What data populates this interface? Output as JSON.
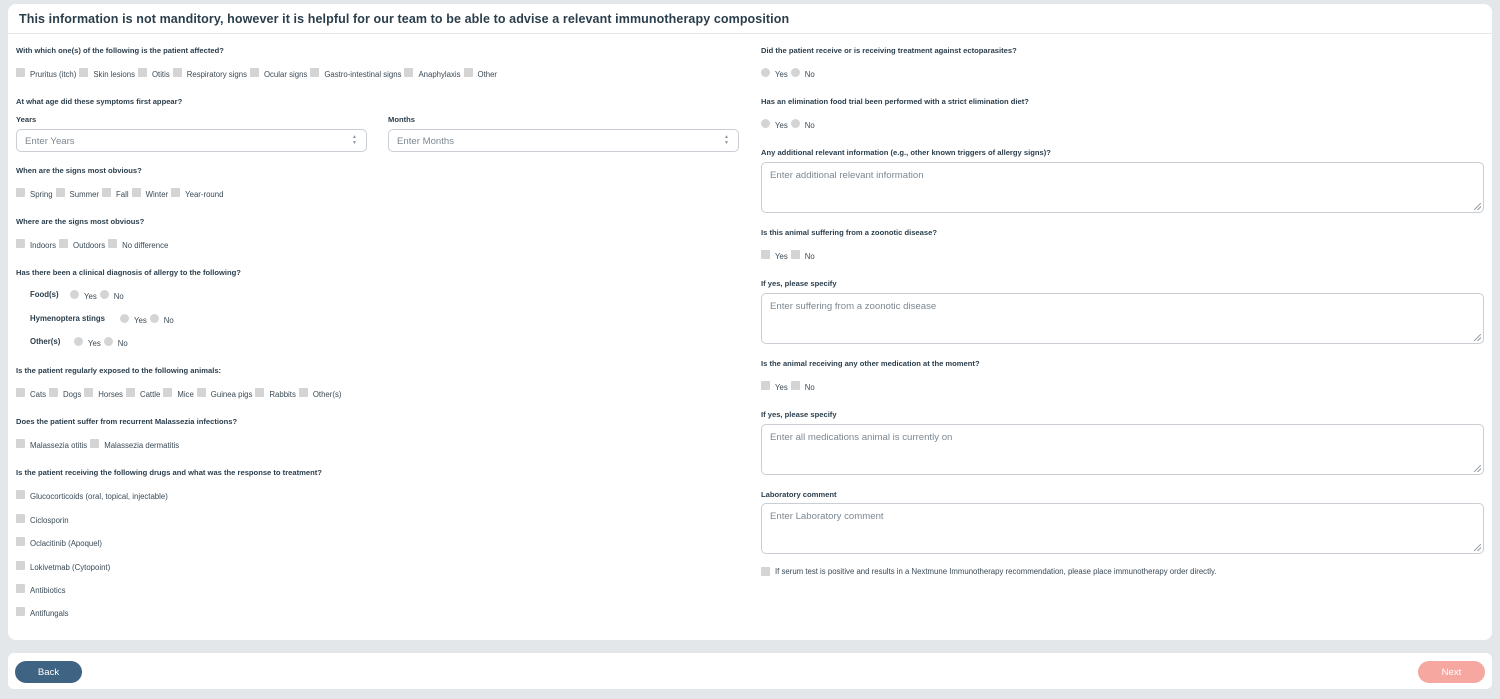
{
  "header": {
    "title": "This information is not manditory, however it is helpful for our team to be able to advise a relevant immunotherapy composition"
  },
  "left": {
    "affected": {
      "question": "With which one(s) of the following is the patient affected?",
      "options": [
        "Pruritus (itch)",
        "Skin lesions",
        "Otitis",
        "Respiratory signs",
        "Ocular signs",
        "Gastro-intestinal signs",
        "Anaphylaxis",
        "Other"
      ]
    },
    "age": {
      "question": "At what age did these symptoms first appear?",
      "years_label": "Years",
      "years_placeholder": "Enter Years",
      "months_label": "Months",
      "months_placeholder": "Enter Months"
    },
    "seasons": {
      "question": "When are the signs most obvious?",
      "options": [
        "Spring",
        "Summer",
        "Fall",
        "Winter",
        "Year-round"
      ]
    },
    "location": {
      "question": "Where are the signs most obvious?",
      "options": [
        "Indoors",
        "Outdoors",
        "No difference"
      ]
    },
    "diagnosis": {
      "question": "Has there been a clinical diagnosis of allergy to the following?",
      "rows": [
        {
          "label": "Food(s)",
          "yes": "Yes",
          "no": "No"
        },
        {
          "label": "Hymenoptera stings",
          "yes": "Yes",
          "no": "No"
        },
        {
          "label": "Other(s)",
          "yes": "Yes",
          "no": "No"
        }
      ]
    },
    "animals": {
      "question": "Is the patient regularly exposed to the following animals:",
      "options": [
        "Cats",
        "Dogs",
        "Horses",
        "Cattle",
        "Mice",
        "Guinea pigs",
        "Rabbits",
        "Other(s)"
      ]
    },
    "malassezia": {
      "question": "Does the patient suffer from recurrent Malassezia infections?",
      "options": [
        "Malassezia otitis",
        "Malassezia dermatitis"
      ]
    },
    "drugs": {
      "question": "Is the patient receiving the following drugs and what was the response to treatment?",
      "options": [
        "Glucocorticoids (oral, topical, injectable)",
        "Ciclosporin",
        "Oclacitinib (Apoquel)",
        "Lokivetmab (Cytopoint)",
        "Antibiotics",
        "Antifungals"
      ]
    }
  },
  "right": {
    "ectoparasites": {
      "question": "Did the patient receive or is receiving treatment against ectoparasites?",
      "yes": "Yes",
      "no": "No"
    },
    "elimination": {
      "question": "Has an elimination food trial been performed with a strict elimination diet?",
      "yes": "Yes",
      "no": "No"
    },
    "additional": {
      "question": "Any additional relevant information (e.g., other known triggers of allergy signs)?",
      "placeholder": "Enter additional relevant information"
    },
    "zoonotic": {
      "question": "Is this animal suffering from a zoonotic disease?",
      "yes": "Yes",
      "no": "No"
    },
    "zoonotic_specify": {
      "question": "If yes, please specify",
      "placeholder": "Enter suffering from a zoonotic disease"
    },
    "medication": {
      "question": "Is the animal receiving any other medication at the moment?",
      "yes": "Yes",
      "no": "No"
    },
    "medication_specify": {
      "question": "If yes, please specify",
      "placeholder": "Enter all medications animal is currently on"
    },
    "lab": {
      "question": "Laboratory comment",
      "placeholder": "Enter Laboratory comment"
    },
    "notice": "If serum test is positive and results in a Nextmune Immunotherapy recommendation, please place immunotherapy order directly."
  },
  "footer": {
    "back": "Back",
    "next": "Next"
  },
  "colors": {
    "back_button": "#3f6382",
    "next_button": "#f6a7a0",
    "text": "#2b3e4c"
  }
}
